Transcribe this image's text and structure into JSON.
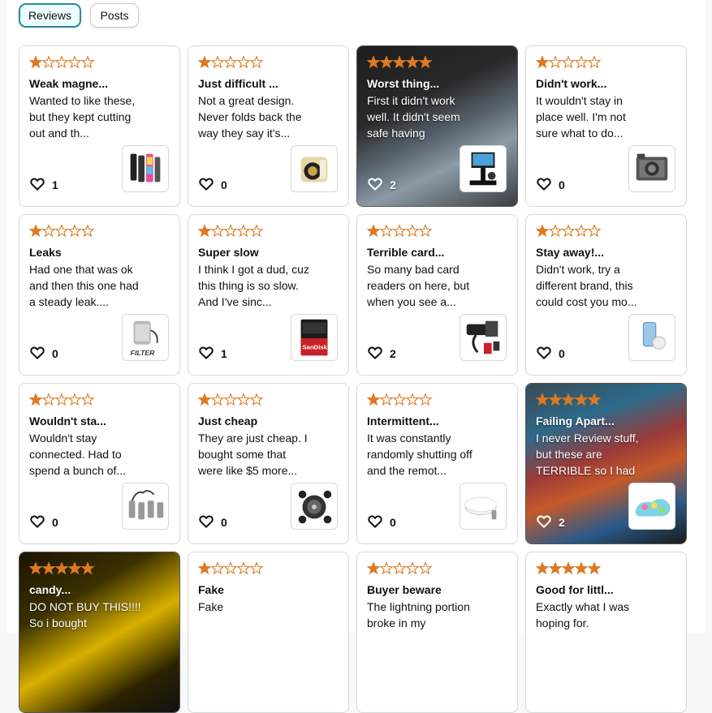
{
  "tabs": [
    {
      "label": "Reviews",
      "active": true
    },
    {
      "label": "Posts",
      "active": false
    }
  ],
  "colors": {
    "star": "#de7921",
    "active_tab_border": "#2b8a99",
    "card_border": "#d5d9d9"
  },
  "icons": {
    "like": "heart-outline-icon",
    "rating": "star-icon"
  },
  "reviews": [
    {
      "rating": 1,
      "title": "Weak magne...",
      "text": "Wanted to like these, but they kept cutting out and th...",
      "likes": "1",
      "product": "rgb light tube lights",
      "dark": false
    },
    {
      "rating": 1,
      "title": "Just difficult ...",
      "text": "Not a great design. Never folds back the way they say it's...",
      "likes": "0",
      "product": "gold folding device",
      "dark": false
    },
    {
      "rating": 5,
      "title": "Worst thing...",
      "text": "First it didn't work well. It didn't seem safe having",
      "likes": "2",
      "product": "teleprompter rig",
      "dark": true
    },
    {
      "rating": 1,
      "title": "Didn't work...",
      "text": "It wouldn't stay in place well. I'm not sure what to do...",
      "likes": "0",
      "product": "camera cage",
      "dark": false
    },
    {
      "rating": 1,
      "title": "Leaks",
      "text": "Had one that was ok and then this one had a steady leak....",
      "likes": "0",
      "product": "water filter",
      "dark": false
    },
    {
      "rating": 1,
      "title": "Super slow",
      "text": "I think I got a dud, cuz this thing is so slow. And I've sinc...",
      "likes": "1",
      "product": "sandisk sd card",
      "dark": false
    },
    {
      "rating": 1,
      "title": "Terrible card...",
      "text": "So many bad card readers on here, but when you see a...",
      "likes": "2",
      "product": "card reader",
      "dark": false
    },
    {
      "rating": 1,
      "title": "Stay away!...",
      "text": "Didn't work, try a different brand, this could cost you mo...",
      "likes": "0",
      "product": "phone accessory",
      "dark": false
    },
    {
      "rating": 1,
      "title": "Wouldn't sta...",
      "text": "Wouldn't stay connected. Had to spend a bunch of...",
      "likes": "0",
      "product": "microphone set",
      "dark": false
    },
    {
      "rating": 1,
      "title": "Just cheap",
      "text": "They are just cheap. I bought some that were like $5 more...",
      "likes": "0",
      "product": "caster wheels",
      "dark": false
    },
    {
      "rating": 1,
      "title": "Intermittent...",
      "text": "It was constantly randomly shutting off and the remot...",
      "likes": "0",
      "product": "puck light",
      "dark": false
    },
    {
      "rating": 5,
      "title": "Failing Apart...",
      "text": "I never Review stuff, but these are TERRIBLE so I had",
      "likes": "2",
      "product": "tie dye clog",
      "dark": true
    },
    {
      "rating": 5,
      "title": "candy...",
      "text": "DO NOT BUY THIS!!!! So i bought",
      "likes": "",
      "product": "",
      "dark": true
    },
    {
      "rating": 1,
      "title": "Fake",
      "text": "Fake",
      "likes": "",
      "product": "",
      "dark": false
    },
    {
      "rating": 1,
      "title": "Buyer beware",
      "text": "The lightning portion broke in my",
      "likes": "",
      "product": "",
      "dark": false
    },
    {
      "rating": 5,
      "title": "Good for littl...",
      "text": "Exactly what I was hoping for.",
      "likes": "",
      "product": "",
      "dark": false
    }
  ]
}
